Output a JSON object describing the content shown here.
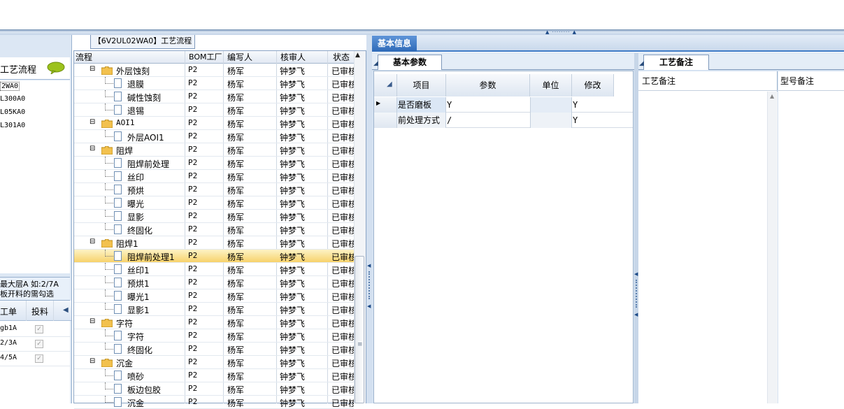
{
  "left": {
    "title": "工艺流程",
    "list_items": [
      "2WA0",
      "L300A0",
      "L05KA0",
      "L301A0"
    ],
    "desc_line1": "最大层A 如:2/7A",
    "desc_line2": "板开料的需勾选",
    "table_headers": [
      "工单",
      "投料"
    ],
    "table_rows": [
      {
        "order": "gb1A",
        "checked": true
      },
      {
        "order": "2/3A",
        "checked": true
      },
      {
        "order": "4/5A",
        "checked": true
      }
    ]
  },
  "middle": {
    "tab_label": "【6V2UL02WA0】工艺流程",
    "headers": {
      "flow": "流程",
      "bom": "BOM工厂",
      "writer": "编写人",
      "reviewer": "核审人",
      "status": "状态"
    },
    "rows": [
      {
        "name": "外层蚀刻",
        "type": "folder",
        "bom": "P2",
        "writer": "杨军",
        "reviewer": "钟梦飞",
        "status": "已审核"
      },
      {
        "name": "退膜",
        "type": "doc",
        "bom": "P2",
        "writer": "杨军",
        "reviewer": "钟梦飞",
        "status": "已审核"
      },
      {
        "name": "碱性蚀刻",
        "type": "doc",
        "bom": "P2",
        "writer": "杨军",
        "reviewer": "钟梦飞",
        "status": "已审核"
      },
      {
        "name": "退锡",
        "type": "doc",
        "bom": "P2",
        "writer": "杨军",
        "reviewer": "钟梦飞",
        "status": "已审核"
      },
      {
        "name": "AOI1",
        "type": "folder",
        "bom": "P2",
        "writer": "杨军",
        "reviewer": "钟梦飞",
        "status": "已审核"
      },
      {
        "name": "外层AOI1",
        "type": "doc",
        "bom": "P2",
        "writer": "杨军",
        "reviewer": "钟梦飞",
        "status": "已审核"
      },
      {
        "name": "阻焊",
        "type": "folder",
        "bom": "P2",
        "writer": "杨军",
        "reviewer": "钟梦飞",
        "status": "已审核"
      },
      {
        "name": "阻焊前处理",
        "type": "doc",
        "bom": "P2",
        "writer": "杨军",
        "reviewer": "钟梦飞",
        "status": "已审核"
      },
      {
        "name": "丝印",
        "type": "doc",
        "bom": "P2",
        "writer": "杨军",
        "reviewer": "钟梦飞",
        "status": "已审核"
      },
      {
        "name": "预烘",
        "type": "doc",
        "bom": "P2",
        "writer": "杨军",
        "reviewer": "钟梦飞",
        "status": "已审核"
      },
      {
        "name": "曝光",
        "type": "doc",
        "bom": "P2",
        "writer": "杨军",
        "reviewer": "钟梦飞",
        "status": "已审核"
      },
      {
        "name": "显影",
        "type": "doc",
        "bom": "P2",
        "writer": "杨军",
        "reviewer": "钟梦飞",
        "status": "已审核"
      },
      {
        "name": "终固化",
        "type": "doc",
        "bom": "P2",
        "writer": "杨军",
        "reviewer": "钟梦飞",
        "status": "已审核"
      },
      {
        "name": "阻焊1",
        "type": "folder",
        "bom": "P2",
        "writer": "杨军",
        "reviewer": "钟梦飞",
        "status": "已审核"
      },
      {
        "name": "阻焊前处理1",
        "type": "doc",
        "bom": "P2",
        "writer": "杨军",
        "reviewer": "钟梦飞",
        "status": "已审核",
        "selected": true
      },
      {
        "name": "丝印1",
        "type": "doc",
        "bom": "P2",
        "writer": "杨军",
        "reviewer": "钟梦飞",
        "status": "已审核"
      },
      {
        "name": "预烘1",
        "type": "doc",
        "bom": "P2",
        "writer": "杨军",
        "reviewer": "钟梦飞",
        "status": "已审核"
      },
      {
        "name": "曝光1",
        "type": "doc",
        "bom": "P2",
        "writer": "杨军",
        "reviewer": "钟梦飞",
        "status": "已审核"
      },
      {
        "name": "显影1",
        "type": "doc",
        "bom": "P2",
        "writer": "杨军",
        "reviewer": "钟梦飞",
        "status": "已审核"
      },
      {
        "name": "字符",
        "type": "folder",
        "bom": "P2",
        "writer": "杨军",
        "reviewer": "钟梦飞",
        "status": "已审核"
      },
      {
        "name": "字符",
        "type": "doc",
        "bom": "P2",
        "writer": "杨军",
        "reviewer": "钟梦飞",
        "status": "已审核"
      },
      {
        "name": "终固化",
        "type": "doc",
        "bom": "P2",
        "writer": "杨军",
        "reviewer": "钟梦飞",
        "status": "已审核"
      },
      {
        "name": "沉金",
        "type": "folder",
        "bom": "P2",
        "writer": "杨军",
        "reviewer": "钟梦飞",
        "status": "已审核"
      },
      {
        "name": "喷砂",
        "type": "doc",
        "bom": "P2",
        "writer": "杨军",
        "reviewer": "钟梦飞",
        "status": "已审核"
      },
      {
        "name": "板边包胶",
        "type": "doc",
        "bom": "P2",
        "writer": "杨军",
        "reviewer": "钟梦飞",
        "status": "已审核"
      },
      {
        "name": "沉金",
        "type": "doc",
        "bom": "P2",
        "writer": "杨军",
        "reviewer": "钟梦飞",
        "status": "已审核"
      }
    ]
  },
  "right": {
    "tab_label": "基本信息",
    "sub_tab_label": "基本参数",
    "grid_headers": [
      "项目",
      "参数",
      "单位",
      "修改"
    ],
    "grid_rows": [
      {
        "item": "是否磨板",
        "param": "Y",
        "unit": "",
        "modify": "Y",
        "current": true
      },
      {
        "item": "前处理方式",
        "param": "/",
        "unit": "",
        "modify": "Y",
        "current": false
      }
    ],
    "memo_tab_label": "工艺备注",
    "memo_headers": [
      "工艺备注",
      "型号备注"
    ]
  },
  "colors": {
    "accent": "#3d7ac6",
    "selected_row": "#f7d26b",
    "folder": "#f2c14e"
  }
}
